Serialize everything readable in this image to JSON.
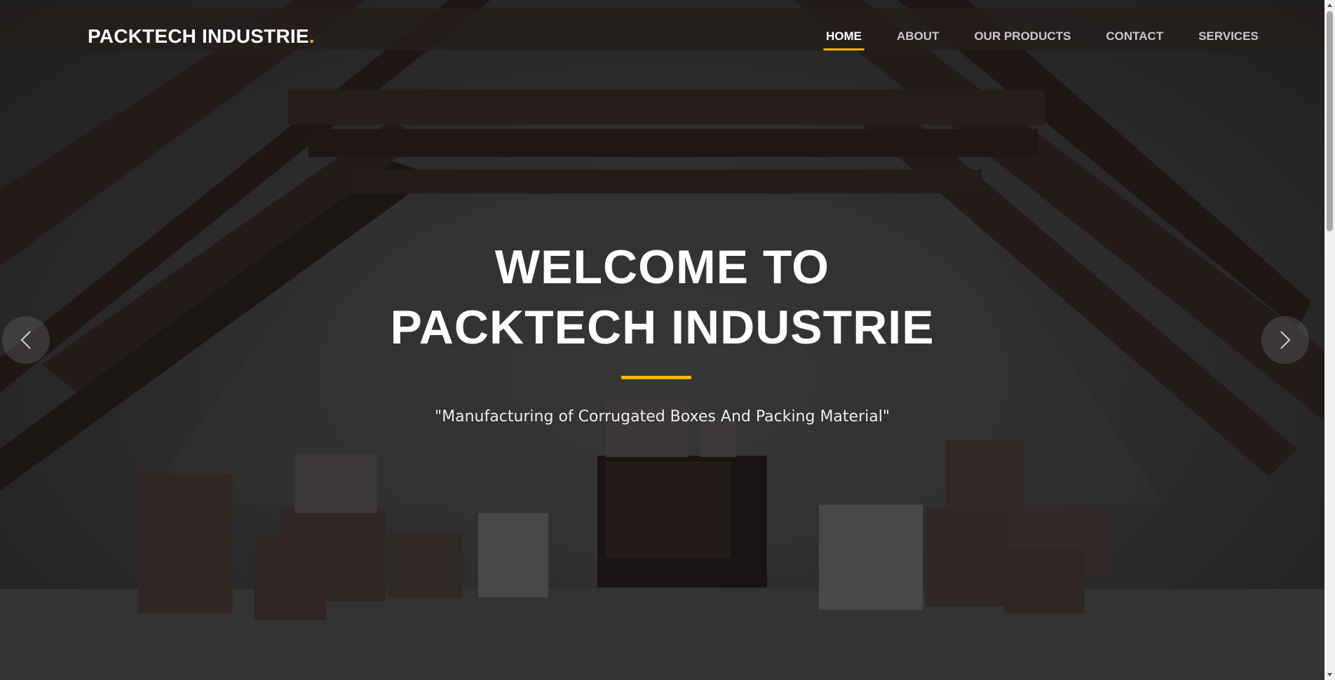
{
  "header": {
    "brand_text": "PACKTECH INDUSTRIE",
    "brand_dot": ".",
    "nav": [
      {
        "label": "HOME",
        "active": true
      },
      {
        "label": "ABOUT",
        "active": false
      },
      {
        "label": "OUR PRODUCTS",
        "active": false
      },
      {
        "label": "CONTACT",
        "active": false
      },
      {
        "label": "SERVICES",
        "active": false
      }
    ]
  },
  "hero": {
    "headline_line1": "WELCOME TO",
    "headline_line2": "PACKTECH INDUSTRIE",
    "tagline": "\"Manufacturing of Corrugated Boxes And Packing Material\"",
    "prev_icon": "chevron-left-icon",
    "next_icon": "chevron-right-icon"
  },
  "colors": {
    "accent": "#f5b400",
    "text": "#ffffff",
    "nav_inactive": "#c9c9c9"
  }
}
